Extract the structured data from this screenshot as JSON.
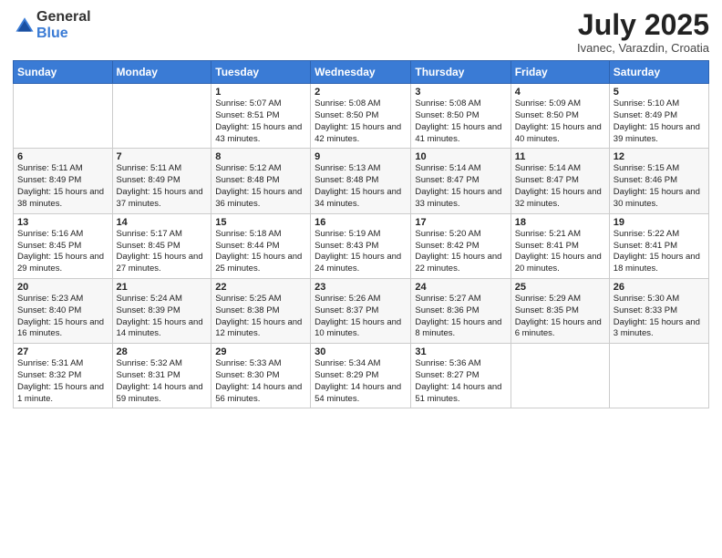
{
  "logo": {
    "general": "General",
    "blue": "Blue"
  },
  "title": "July 2025",
  "subtitle": "Ivanec, Varazdin, Croatia",
  "days_of_week": [
    "Sunday",
    "Monday",
    "Tuesday",
    "Wednesday",
    "Thursday",
    "Friday",
    "Saturday"
  ],
  "weeks": [
    [
      {
        "day": "",
        "sunrise": "",
        "sunset": "",
        "daylight": ""
      },
      {
        "day": "",
        "sunrise": "",
        "sunset": "",
        "daylight": ""
      },
      {
        "day": "1",
        "sunrise": "Sunrise: 5:07 AM",
        "sunset": "Sunset: 8:51 PM",
        "daylight": "Daylight: 15 hours and 43 minutes."
      },
      {
        "day": "2",
        "sunrise": "Sunrise: 5:08 AM",
        "sunset": "Sunset: 8:50 PM",
        "daylight": "Daylight: 15 hours and 42 minutes."
      },
      {
        "day": "3",
        "sunrise": "Sunrise: 5:08 AM",
        "sunset": "Sunset: 8:50 PM",
        "daylight": "Daylight: 15 hours and 41 minutes."
      },
      {
        "day": "4",
        "sunrise": "Sunrise: 5:09 AM",
        "sunset": "Sunset: 8:50 PM",
        "daylight": "Daylight: 15 hours and 40 minutes."
      },
      {
        "day": "5",
        "sunrise": "Sunrise: 5:10 AM",
        "sunset": "Sunset: 8:49 PM",
        "daylight": "Daylight: 15 hours and 39 minutes."
      }
    ],
    [
      {
        "day": "6",
        "sunrise": "Sunrise: 5:11 AM",
        "sunset": "Sunset: 8:49 PM",
        "daylight": "Daylight: 15 hours and 38 minutes."
      },
      {
        "day": "7",
        "sunrise": "Sunrise: 5:11 AM",
        "sunset": "Sunset: 8:49 PM",
        "daylight": "Daylight: 15 hours and 37 minutes."
      },
      {
        "day": "8",
        "sunrise": "Sunrise: 5:12 AM",
        "sunset": "Sunset: 8:48 PM",
        "daylight": "Daylight: 15 hours and 36 minutes."
      },
      {
        "day": "9",
        "sunrise": "Sunrise: 5:13 AM",
        "sunset": "Sunset: 8:48 PM",
        "daylight": "Daylight: 15 hours and 34 minutes."
      },
      {
        "day": "10",
        "sunrise": "Sunrise: 5:14 AM",
        "sunset": "Sunset: 8:47 PM",
        "daylight": "Daylight: 15 hours and 33 minutes."
      },
      {
        "day": "11",
        "sunrise": "Sunrise: 5:14 AM",
        "sunset": "Sunset: 8:47 PM",
        "daylight": "Daylight: 15 hours and 32 minutes."
      },
      {
        "day": "12",
        "sunrise": "Sunrise: 5:15 AM",
        "sunset": "Sunset: 8:46 PM",
        "daylight": "Daylight: 15 hours and 30 minutes."
      }
    ],
    [
      {
        "day": "13",
        "sunrise": "Sunrise: 5:16 AM",
        "sunset": "Sunset: 8:45 PM",
        "daylight": "Daylight: 15 hours and 29 minutes."
      },
      {
        "day": "14",
        "sunrise": "Sunrise: 5:17 AM",
        "sunset": "Sunset: 8:45 PM",
        "daylight": "Daylight: 15 hours and 27 minutes."
      },
      {
        "day": "15",
        "sunrise": "Sunrise: 5:18 AM",
        "sunset": "Sunset: 8:44 PM",
        "daylight": "Daylight: 15 hours and 25 minutes."
      },
      {
        "day": "16",
        "sunrise": "Sunrise: 5:19 AM",
        "sunset": "Sunset: 8:43 PM",
        "daylight": "Daylight: 15 hours and 24 minutes."
      },
      {
        "day": "17",
        "sunrise": "Sunrise: 5:20 AM",
        "sunset": "Sunset: 8:42 PM",
        "daylight": "Daylight: 15 hours and 22 minutes."
      },
      {
        "day": "18",
        "sunrise": "Sunrise: 5:21 AM",
        "sunset": "Sunset: 8:41 PM",
        "daylight": "Daylight: 15 hours and 20 minutes."
      },
      {
        "day": "19",
        "sunrise": "Sunrise: 5:22 AM",
        "sunset": "Sunset: 8:41 PM",
        "daylight": "Daylight: 15 hours and 18 minutes."
      }
    ],
    [
      {
        "day": "20",
        "sunrise": "Sunrise: 5:23 AM",
        "sunset": "Sunset: 8:40 PM",
        "daylight": "Daylight: 15 hours and 16 minutes."
      },
      {
        "day": "21",
        "sunrise": "Sunrise: 5:24 AM",
        "sunset": "Sunset: 8:39 PM",
        "daylight": "Daylight: 15 hours and 14 minutes."
      },
      {
        "day": "22",
        "sunrise": "Sunrise: 5:25 AM",
        "sunset": "Sunset: 8:38 PM",
        "daylight": "Daylight: 15 hours and 12 minutes."
      },
      {
        "day": "23",
        "sunrise": "Sunrise: 5:26 AM",
        "sunset": "Sunset: 8:37 PM",
        "daylight": "Daylight: 15 hours and 10 minutes."
      },
      {
        "day": "24",
        "sunrise": "Sunrise: 5:27 AM",
        "sunset": "Sunset: 8:36 PM",
        "daylight": "Daylight: 15 hours and 8 minutes."
      },
      {
        "day": "25",
        "sunrise": "Sunrise: 5:29 AM",
        "sunset": "Sunset: 8:35 PM",
        "daylight": "Daylight: 15 hours and 6 minutes."
      },
      {
        "day": "26",
        "sunrise": "Sunrise: 5:30 AM",
        "sunset": "Sunset: 8:33 PM",
        "daylight": "Daylight: 15 hours and 3 minutes."
      }
    ],
    [
      {
        "day": "27",
        "sunrise": "Sunrise: 5:31 AM",
        "sunset": "Sunset: 8:32 PM",
        "daylight": "Daylight: 15 hours and 1 minute."
      },
      {
        "day": "28",
        "sunrise": "Sunrise: 5:32 AM",
        "sunset": "Sunset: 8:31 PM",
        "daylight": "Daylight: 14 hours and 59 minutes."
      },
      {
        "day": "29",
        "sunrise": "Sunrise: 5:33 AM",
        "sunset": "Sunset: 8:30 PM",
        "daylight": "Daylight: 14 hours and 56 minutes."
      },
      {
        "day": "30",
        "sunrise": "Sunrise: 5:34 AM",
        "sunset": "Sunset: 8:29 PM",
        "daylight": "Daylight: 14 hours and 54 minutes."
      },
      {
        "day": "31",
        "sunrise": "Sunrise: 5:36 AM",
        "sunset": "Sunset: 8:27 PM",
        "daylight": "Daylight: 14 hours and 51 minutes."
      },
      {
        "day": "",
        "sunrise": "",
        "sunset": "",
        "daylight": ""
      },
      {
        "day": "",
        "sunrise": "",
        "sunset": "",
        "daylight": ""
      }
    ]
  ]
}
